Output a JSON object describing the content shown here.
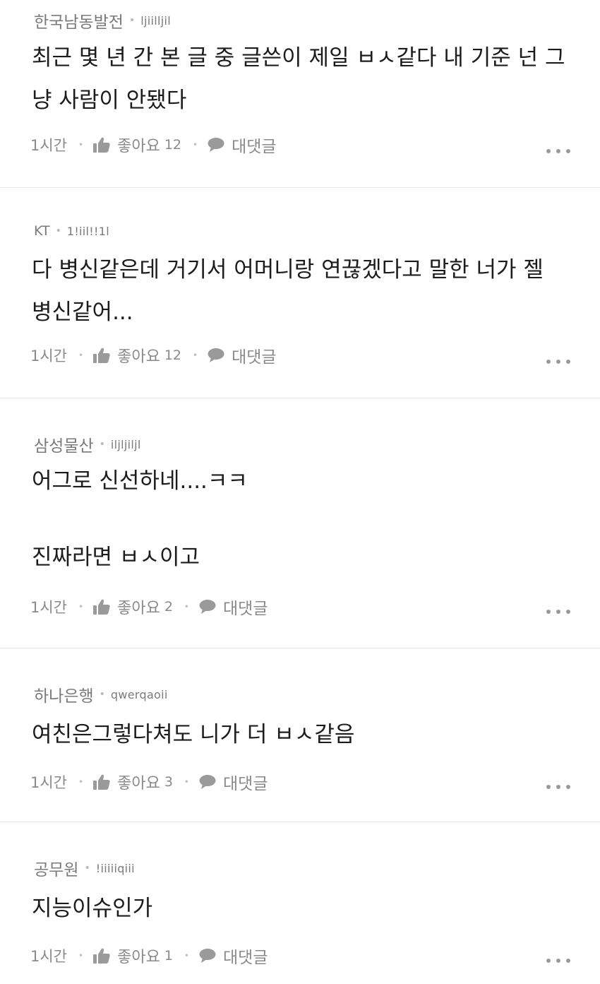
{
  "comments": [
    {
      "company": "한국남동발전",
      "nickname": "ljiilljil",
      "lines": [
        "최근 몇 년 간 본 글 중 글쓴이 제일 ㅂㅅ같다 내 기준 넌 그",
        "냥 사람이 안됐다"
      ],
      "time": "1시간",
      "like_label": "좋아요",
      "like_count": "12",
      "reply_label": "대댓글"
    },
    {
      "company": "KT",
      "nickname": "1!iil!!1l",
      "lines": [
        "다 병신같은데 거기서 어머니랑 연끊겠다고 말한 너가 젤",
        "병신같어..."
      ],
      "time": "1시간",
      "like_label": "좋아요",
      "like_count": "12",
      "reply_label": "대댓글"
    },
    {
      "company": "삼성물산",
      "nickname": "iljljiljl",
      "lines": [
        "어그로 신선하네....ㅋㅋ",
        "",
        "진짜라면 ㅂㅅ이고"
      ],
      "time": "1시간",
      "like_label": "좋아요",
      "like_count": "2",
      "reply_label": "대댓글"
    },
    {
      "company": "하나은행",
      "nickname": "qwerqaoii",
      "lines": [
        "여친은그렇다쳐도 니가 더 ㅂㅅ같음"
      ],
      "time": "1시간",
      "like_label": "좋아요",
      "like_count": "3",
      "reply_label": "대댓글"
    },
    {
      "company": "공무원",
      "nickname": "!iiiiiqiii",
      "lines": [
        "지능이슈인가"
      ],
      "time": "1시간",
      "like_label": "좋아요",
      "like_count": "1",
      "reply_label": "대댓글"
    }
  ],
  "icons": {
    "like": "thumbs-up-icon",
    "reply": "speech-bubble-icon",
    "more": "more-dots-icon"
  },
  "colors": {
    "text": "#1c1c1c",
    "meta": "#7a7a7a",
    "divider": "#e6e6e6"
  }
}
